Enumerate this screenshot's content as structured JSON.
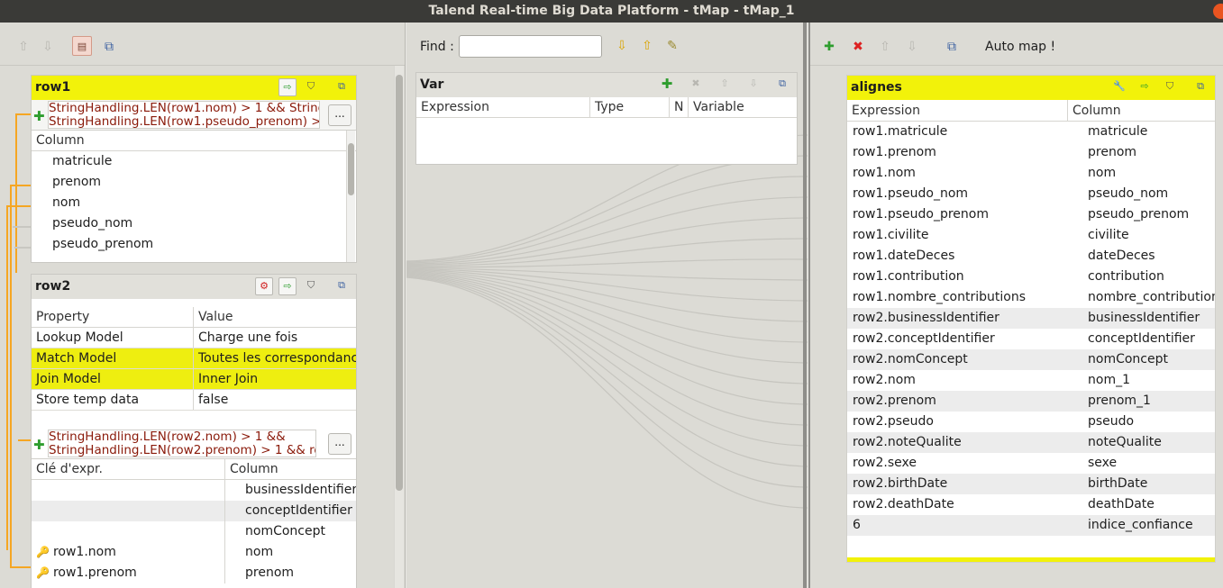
{
  "window": {
    "title": "Talend Real-time Big Data Platform - tMap - tMap_1"
  },
  "left_toolbar": {
    "icons": [
      "arrow-up-icon",
      "arrow-down-icon",
      "layout-icon",
      "window-icon"
    ]
  },
  "row1": {
    "title": "row1",
    "filter_line1": "StringHandling.LEN(row1.nom) > 1 && String",
    "filter_line2": "StringHandling.LEN(row1.pseudo_prenom) >",
    "filter_button": "...",
    "column_header": "Column",
    "columns": [
      "matricule",
      "prenom",
      "nom",
      "pseudo_nom",
      "pseudo_prenom"
    ]
  },
  "row2": {
    "title": "row2",
    "property_headers": {
      "property": "Property",
      "value": "Value"
    },
    "properties": [
      {
        "property": "Lookup Model",
        "value": "Charge une fois"
      },
      {
        "property": "Match Model",
        "value": "Toutes les correspondanc"
      },
      {
        "property": "Join Model",
        "value": "Inner Join"
      },
      {
        "property": "Store temp data",
        "value": "false"
      }
    ],
    "filter_line1": "StringHandling.LEN(row2.nom) > 1 &&",
    "filter_line2": "StringHandling.LEN(row2.prenom) > 1 && row",
    "filter_button": "...",
    "key_headers": {
      "key": "Clé d'expr.",
      "column": "Column"
    },
    "keys": [
      {
        "key": "",
        "column": "businessIdentifier"
      },
      {
        "key": "",
        "column": "conceptIdentifier"
      },
      {
        "key": "",
        "column": "nomConcept"
      },
      {
        "key": "row1.nom",
        "column": "nom"
      },
      {
        "key": "row1.prenom",
        "column": "prenom"
      }
    ]
  },
  "find": {
    "label": "Find :",
    "value": ""
  },
  "var": {
    "title": "Var",
    "headers": {
      "expression": "Expression",
      "type": "Type",
      "n": "N",
      "variable": "Variable"
    }
  },
  "right_toolbar": {
    "automap_label": "Auto map !"
  },
  "output": {
    "title": "alignes",
    "headers": {
      "expression": "Expression",
      "column": "Column"
    },
    "rows": [
      {
        "expression": "row1.matricule",
        "column": "matricule"
      },
      {
        "expression": "row1.prenom",
        "column": "prenom"
      },
      {
        "expression": "row1.nom",
        "column": "nom"
      },
      {
        "expression": "row1.pseudo_nom",
        "column": "pseudo_nom"
      },
      {
        "expression": "row1.pseudo_prenom",
        "column": "pseudo_prenom"
      },
      {
        "expression": "row1.civilite",
        "column": "civilite"
      },
      {
        "expression": "row1.dateDeces",
        "column": "dateDeces"
      },
      {
        "expression": "row1.contribution",
        "column": "contribution"
      },
      {
        "expression": "row1.nombre_contributions",
        "column": "nombre_contribution"
      },
      {
        "expression": "row2.businessIdentifier",
        "column": "businessIdentifier"
      },
      {
        "expression": "row2.conceptIdentifier",
        "column": "conceptIdentifier"
      },
      {
        "expression": "row2.nomConcept",
        "column": "nomConcept"
      },
      {
        "expression": "row2.nom",
        "column": "nom_1"
      },
      {
        "expression": "row2.prenom",
        "column": "prenom_1"
      },
      {
        "expression": "row2.pseudo",
        "column": "pseudo"
      },
      {
        "expression": "row2.noteQualite",
        "column": "noteQualite"
      },
      {
        "expression": "row2.sexe",
        "column": "sexe"
      },
      {
        "expression": "row2.birthDate",
        "column": "birthDate"
      },
      {
        "expression": "row2.deathDate",
        "column": "deathDate"
      },
      {
        "expression": "6",
        "column": "indice_confiance"
      }
    ]
  },
  "colors": {
    "header_yellow": "#f2f20a",
    "match_yellow": "#eeee10",
    "link_orange": "#f5a623",
    "filter_red": "#8a1a0a"
  }
}
